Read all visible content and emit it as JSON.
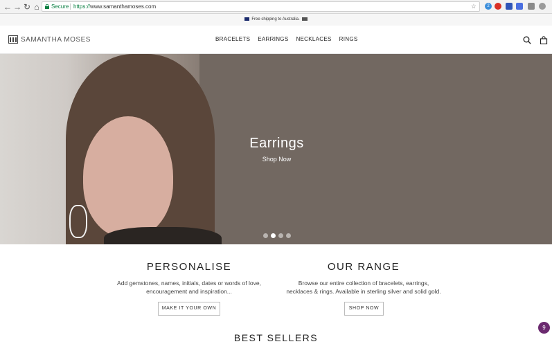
{
  "browser": {
    "secure_label": "Secure",
    "url_proto": "https://",
    "url_rest": "www.samanthamoses.com",
    "extension_badge": "2"
  },
  "announcement": {
    "text": "Free shipping to Australia."
  },
  "header": {
    "logo_text": "SAMANTHA MOSES",
    "menu": [
      "BRACELETS",
      "EARRINGS",
      "NECKLACES",
      "RINGS"
    ]
  },
  "hero": {
    "title": "Earrings",
    "cta": "Shop Now",
    "slide_count": 4,
    "active_slide": 2
  },
  "promos": [
    {
      "title": "PERSONALISE",
      "line1": "Add gemstones, names, initials, dates or words of love,",
      "line2": "encouragement and inspiration...",
      "button": "MAKE IT YOUR OWN"
    },
    {
      "title": "OUR RANGE",
      "line1": "Browse our entire collection of bracelets, earrings,",
      "line2": "necklaces & rings. Available in sterling silver and solid gold.",
      "button": "SHOP NOW"
    }
  ],
  "best_sellers": {
    "title": "BEST SELLERS"
  },
  "chat": {
    "badge": "9"
  },
  "colors": {
    "accent_purple": "#6b2a6f",
    "secure_green": "#0b8043"
  }
}
